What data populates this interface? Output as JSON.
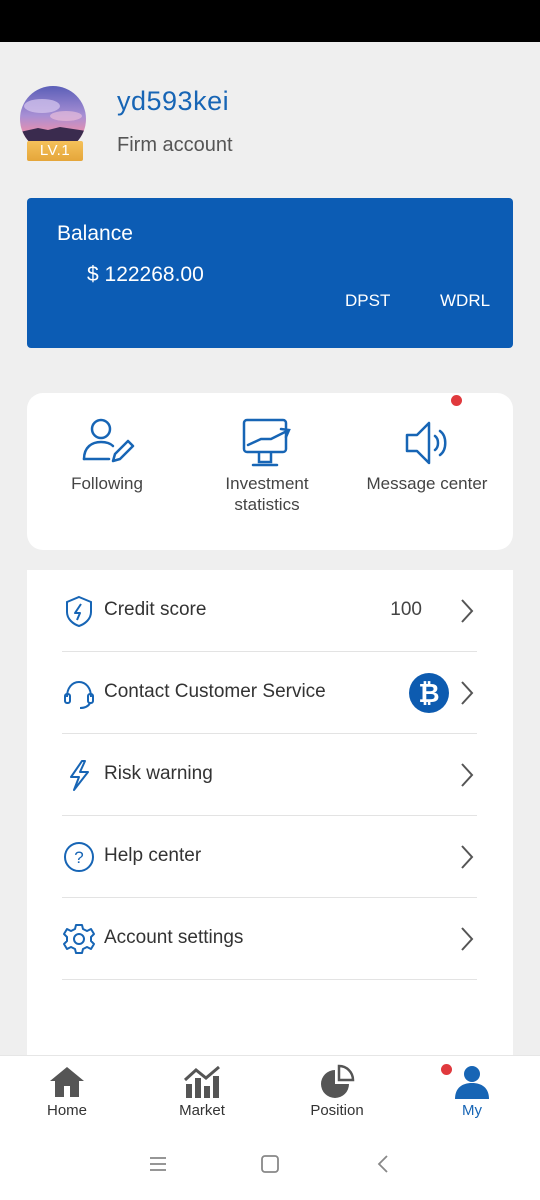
{
  "profile": {
    "username": "yd593kei",
    "account_type": "Firm account",
    "level": "LV.1"
  },
  "balance": {
    "label": "Balance",
    "value": "$ 122268.00",
    "deposit_label": "DPST",
    "withdraw_label": "WDRL"
  },
  "quick_actions": [
    {
      "label": "Following",
      "icon": "user-edit-icon"
    },
    {
      "label": "Investment statistics",
      "icon": "monitor-chart-icon"
    },
    {
      "label": "Message center",
      "icon": "speaker-icon",
      "has_notification": true
    }
  ],
  "menu": [
    {
      "label": "Credit score",
      "value": "100",
      "icon": "shield-bolt-icon"
    },
    {
      "label": "Contact Customer Service",
      "icon": "headset-icon",
      "badge": "bitcoin-icon"
    },
    {
      "label": "Risk warning",
      "icon": "lightning-icon"
    },
    {
      "label": "Help center",
      "icon": "help-circle-icon"
    },
    {
      "label": "Account settings",
      "icon": "gear-icon"
    }
  ],
  "bottom_nav": [
    {
      "label": "Home",
      "icon": "home-icon"
    },
    {
      "label": "Market",
      "icon": "market-chart-icon"
    },
    {
      "label": "Position",
      "icon": "pie-chart-icon"
    },
    {
      "label": "My",
      "icon": "person-icon",
      "active": true,
      "has_notification": true
    }
  ],
  "colors": {
    "primary": "#0c5cb4",
    "accent_text": "#1765b5",
    "notification": "#e0393d",
    "background": "#efefef"
  }
}
